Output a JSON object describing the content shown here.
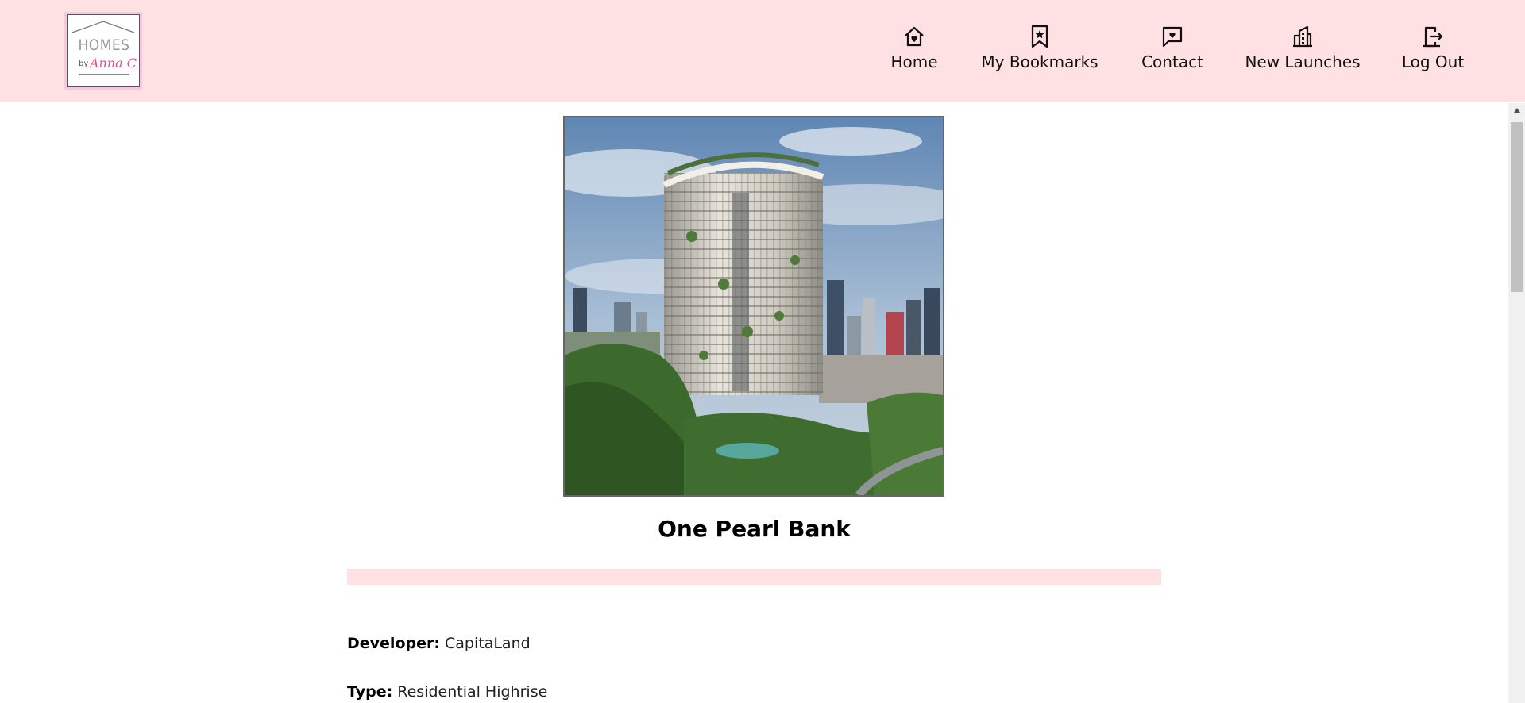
{
  "header": {
    "logo": {
      "word": "HOMES",
      "by": "by",
      "name": "Anna C"
    },
    "nav": [
      {
        "label": "Home",
        "icon": "home-heart-icon"
      },
      {
        "label": "My Bookmarks",
        "icon": "bookmark-star-icon"
      },
      {
        "label": "Contact",
        "icon": "chat-heart-icon"
      },
      {
        "label": "New Launches",
        "icon": "buildings-icon"
      },
      {
        "label": "Log Out",
        "icon": "logout-door-icon"
      }
    ]
  },
  "property": {
    "image_alt": "One Pearl Bank tower",
    "title": "One Pearl Bank",
    "details": [
      {
        "label": "Developer:",
        "value": "CapitaLand"
      },
      {
        "label": "Type:",
        "value": "Residential Highrise"
      }
    ]
  },
  "colors": {
    "header_bg": "#ffe0e3",
    "accent_pink": "#e04d8c"
  }
}
